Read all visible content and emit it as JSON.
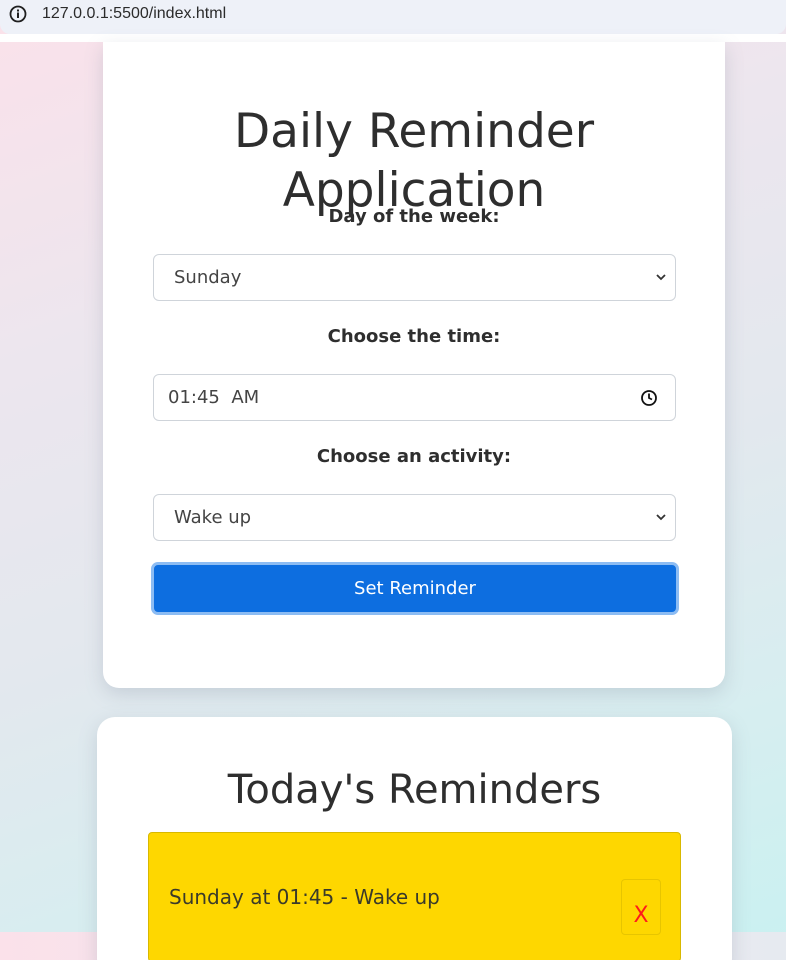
{
  "browser": {
    "url": "127.0.0.1:5500/index.html",
    "info_icon": "info-icon"
  },
  "form": {
    "title_line1": "Daily Reminder",
    "title_line2": "Application",
    "day_label": "Day of the week:",
    "day_value": "Sunday",
    "time_label": "Choose the time:",
    "time_value": "01:45  AM",
    "activity_label": "Choose an activity:",
    "activity_value": "Wake up",
    "submit_label": "Set Reminder"
  },
  "reminders": {
    "heading": "Today's Reminders",
    "items": [
      {
        "text": "Sunday at 01:45 - Wake up",
        "delete_label": "X"
      }
    ]
  },
  "colors": {
    "button": "#0d6ee0",
    "reminder_bg": "#fed700",
    "delete": "#ff1a1a"
  }
}
